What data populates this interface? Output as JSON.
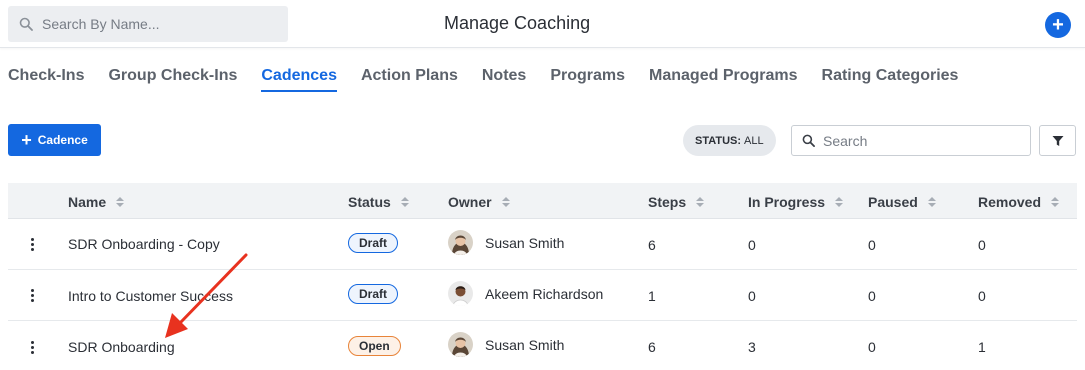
{
  "header": {
    "search_placeholder": "Search By Name...",
    "title": "Manage Coaching",
    "add_icon": "plus-icon"
  },
  "tabs": [
    {
      "label": "Check-Ins",
      "active": false
    },
    {
      "label": "Group Check-Ins",
      "active": false
    },
    {
      "label": "Cadences",
      "active": true
    },
    {
      "label": "Action Plans",
      "active": false
    },
    {
      "label": "Notes",
      "active": false
    },
    {
      "label": "Programs",
      "active": false
    },
    {
      "label": "Managed Programs",
      "active": false
    },
    {
      "label": "Rating Categories",
      "active": false
    }
  ],
  "toolbar": {
    "add_cadence_label": "Cadence",
    "status_filter_key": "STATUS:",
    "status_filter_value": "ALL",
    "search_placeholder": "Search",
    "filter_icon": "filter-icon"
  },
  "table": {
    "columns": [
      "Name",
      "Status",
      "Owner",
      "Steps",
      "In Progress",
      "Paused",
      "Removed"
    ],
    "rows": [
      {
        "name": "SDR Onboarding - Copy",
        "status": "Draft",
        "owner": "Susan Smith",
        "steps": "6",
        "in_progress": "0",
        "paused": "0",
        "removed": "0"
      },
      {
        "name": "Intro to Customer Success",
        "status": "Draft",
        "owner": "Akeem Richardson",
        "steps": "1",
        "in_progress": "0",
        "paused": "0",
        "removed": "0"
      },
      {
        "name": "SDR Onboarding",
        "status": "Open",
        "owner": "Susan Smith",
        "steps": "6",
        "in_progress": "3",
        "paused": "0",
        "removed": "1"
      }
    ]
  },
  "colors": {
    "accent": "#1468e0",
    "draft_border": "#1468e0",
    "open_border": "#e8843a",
    "annotation_arrow": "#e8321f"
  }
}
